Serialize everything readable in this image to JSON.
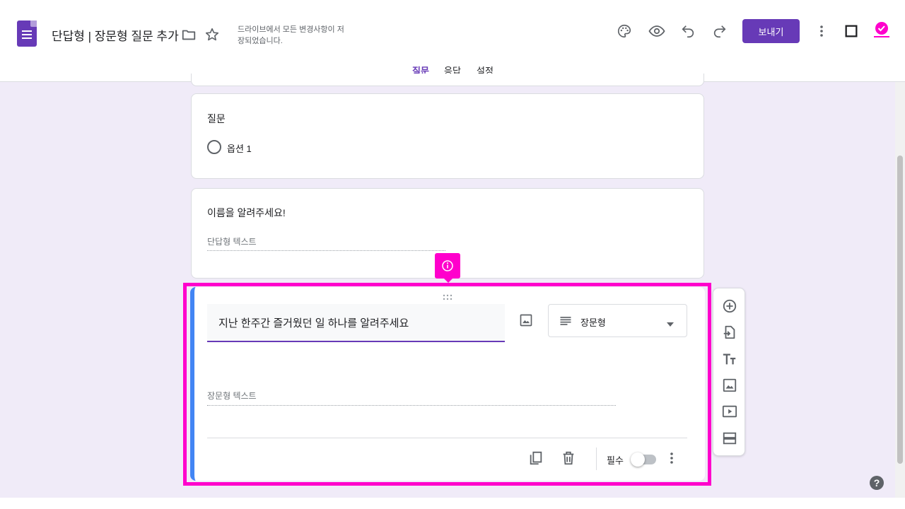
{
  "header": {
    "title": "단답형 | 장문형 질문 추가",
    "save_status": "드라이브에서 모든 변경사항이 저장되었습니다.",
    "send_label": "보내기"
  },
  "tabs": [
    {
      "label": "질문",
      "active": true
    },
    {
      "label": "응답",
      "active": false
    },
    {
      "label": "설정",
      "active": false
    }
  ],
  "questions": [
    {
      "title": "질문",
      "option_label": "옵션 1"
    },
    {
      "title": "이름을 알려주세요!",
      "answer_placeholder": "단답형 텍스트"
    }
  ],
  "active_question": {
    "title": "지난 한주간 즐거웠던 일 하나를 알려주세요",
    "type_label": "장문형",
    "answer_placeholder": "장문형 텍스트",
    "required_label": "필수",
    "required": false
  },
  "colors": {
    "accent": "#673ab7",
    "background": "#f0ebf8",
    "highlight": "#ff00cc",
    "active_border": "#4285f4"
  },
  "icons": [
    "forms-logo-icon",
    "folder-icon",
    "star-icon",
    "palette-icon",
    "preview-eye-icon",
    "undo-icon",
    "redo-icon",
    "more-vert-icon",
    "fullscreen-icon",
    "image-icon",
    "short-text-icon",
    "dropdown-arrow-icon",
    "copy-icon",
    "delete-icon",
    "add-circle-icon",
    "import-icon",
    "title-icon",
    "image-add-icon",
    "video-icon",
    "section-icon",
    "info-icon",
    "help-icon",
    "drag-handle-icon"
  ]
}
